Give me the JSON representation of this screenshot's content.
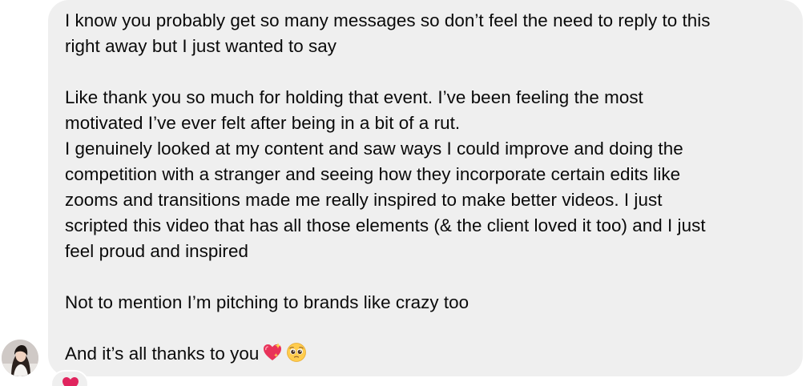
{
  "message": {
    "lines": [
      "I know you probably get so many messages so don’t feel the need to reply to this",
      "right away but I just wanted to say",
      "",
      "Like thank you so much for holding that event. I’ve been feeling the most",
      "motivated I’ve ever felt after being in a bit of a rut.",
      "I genuinely looked at my content and saw ways I could improve and doing the",
      "competition with a stranger and seeing how they incorporate certain edits like",
      "zooms and transitions made me really inspired to make better videos. I just",
      "scripted this video that has all those elements (& the client loved it too) and I just",
      "feel proud and inspired",
      "",
      "Not to mention I’m pitching to brands like crazy too",
      "",
      "And it’s all thanks to you"
    ],
    "trailing_emojis": [
      "sparkling-heart-icon",
      "pleading-face-icon"
    ],
    "bubble_color": "#efefef",
    "text_color": "#0a0a0a"
  },
  "sender": {
    "avatar_icon": "avatar"
  },
  "reaction": {
    "icon": "red-heart-icon",
    "color": "#e0245e"
  }
}
